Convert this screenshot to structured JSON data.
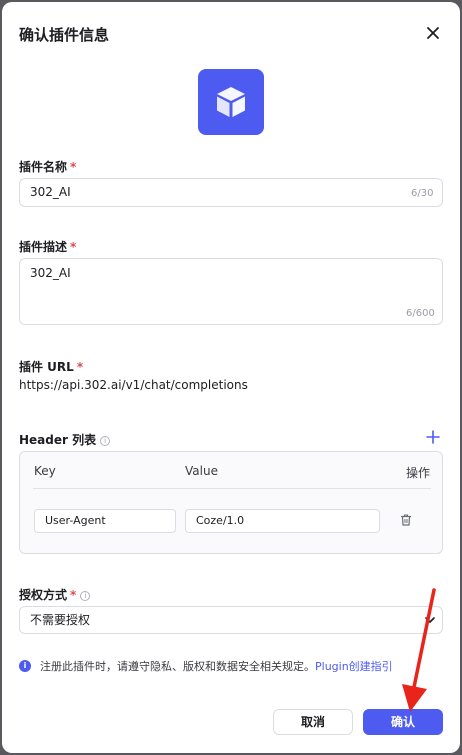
{
  "dialog": {
    "title": "确认插件信息",
    "close_icon": "close-icon",
    "plugin_icon": "cube-icon",
    "accent_color": "#4e5bf0"
  },
  "name_field": {
    "label": "插件名称",
    "required_mark": "*",
    "value": "302_AI",
    "counter": "6/30"
  },
  "desc_field": {
    "label": "插件描述",
    "required_mark": "*",
    "value": "302_AI",
    "counter": "6/600"
  },
  "url_field": {
    "label": "插件 URL",
    "required_mark": "*",
    "value": "https://api.302.ai/v1/chat/completions"
  },
  "headers": {
    "label": "Header 列表",
    "info_icon": "info-icon",
    "add_icon": "plus-icon",
    "columns": [
      "Key",
      "Value",
      "操作"
    ],
    "rows": [
      {
        "key": "User-Agent",
        "value": "Coze/1.0",
        "action_icon": "trash-icon"
      }
    ]
  },
  "auth_field": {
    "label": "授权方式",
    "required_mark": "*",
    "info_icon": "info-icon",
    "selected": "不需要授权",
    "dropdown_icon": "chevron-down-icon"
  },
  "notice": {
    "text": "注册此插件时，请遵守隐私、版权和数据安全相关规定。",
    "link": "Plugin创建指引",
    "icon": "info-filled-icon"
  },
  "footer": {
    "cancel_label": "取消",
    "confirm_label": "确认"
  },
  "annotation": {
    "arrow_color": "#e8241b"
  }
}
